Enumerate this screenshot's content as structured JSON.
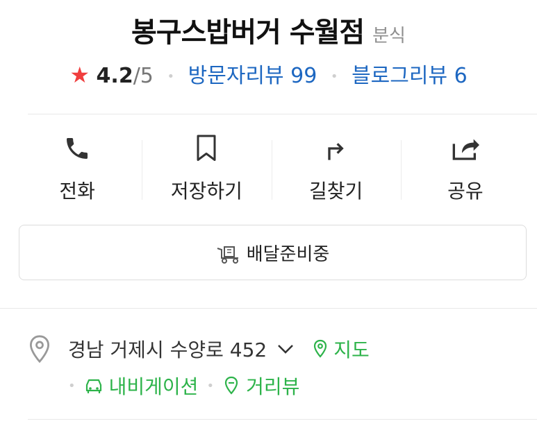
{
  "place": {
    "name": "봉구스밥버거 수월점",
    "category": "분식"
  },
  "rating": {
    "score": "4.2",
    "max": "/5",
    "visitor_reviews": "방문자리뷰 99",
    "blog_reviews": "블로그리뷰 6"
  },
  "actions": [
    {
      "label": "전화",
      "icon": "phone-icon"
    },
    {
      "label": "저장하기",
      "icon": "bookmark-icon"
    },
    {
      "label": "길찾기",
      "icon": "directions-icon"
    },
    {
      "label": "공유",
      "icon": "share-icon"
    }
  ],
  "delivery": {
    "label": "배달준비중",
    "icon": "delivery-cart-icon"
  },
  "address": {
    "text": "경남 거제시 수양로 452",
    "map_label": "지도",
    "navigation_label": "내비게이션",
    "street_view_label": "거리뷰"
  },
  "colors": {
    "star": "#f03e3e",
    "link_blue": "#1d67c1",
    "link_green": "#2db34a"
  }
}
